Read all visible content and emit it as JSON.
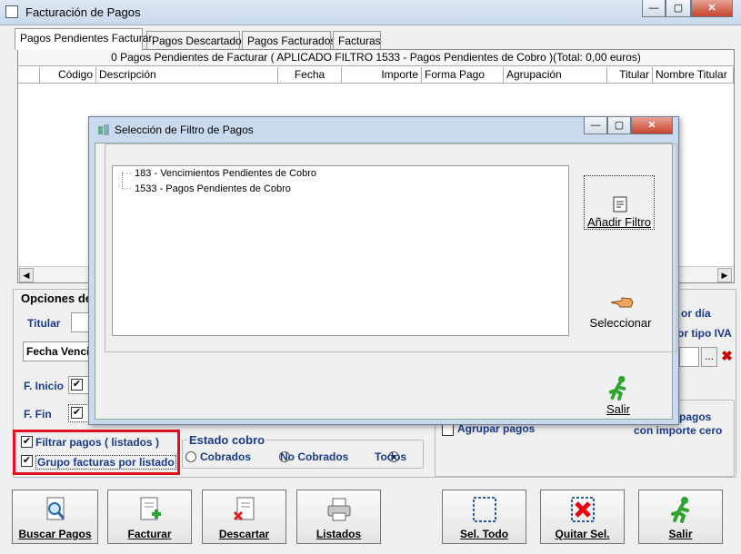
{
  "window": {
    "title": "Facturación de Pagos"
  },
  "tabs": [
    {
      "label": "Pagos Pendientes Facturar",
      "active": true
    },
    {
      "label": "Pagos Descartados"
    },
    {
      "label": "Pagos Facturados"
    },
    {
      "label": "Facturas"
    }
  ],
  "grid": {
    "info": "0 Pagos Pendientes de Facturar ( APLICADO FILTRO 1533 - Pagos Pendientes de Cobro )(Total: 0,00 euros)",
    "columns": [
      "Código",
      "Descripción",
      "Fecha",
      "Importe",
      "Forma Pago",
      "Agrupación",
      "Titular",
      "Nombre Titular"
    ]
  },
  "options": {
    "title": "Opciones de",
    "titular_label": "Titular",
    "fecha_value": "Fecha Venci",
    "finicio_label": "F. Inicio",
    "ffin_label": "F. Fin",
    "por_dia": "or día",
    "por_tipo_iva": "or tipo IVA",
    "agrupar_pagos": "Agrupar pagos",
    "pagos": "pagos",
    "importe_cero": "con importe cero"
  },
  "filters": {
    "filtrar_pagos": "Filtrar pagos ( listados )",
    "grupo_facturas": "Grupo facturas por listado",
    "estado_title": "Estado cobro",
    "cobrados": "Cobrados",
    "no_cobrados": "No Cobrados",
    "todos": "Todos"
  },
  "buttons": {
    "buscar": "Buscar Pagos",
    "facturar": "Facturar",
    "descartar": "Descartar",
    "listados": "Listados",
    "sel_todo": "Sel. Todo",
    "quitar_sel": "Quitar Sel.",
    "salir": "Salir"
  },
  "dialog": {
    "title": "Selección de Filtro de Pagos",
    "tree": [
      "183 - Vencimientos Pendientes de Cobro",
      "1533 - Pagos Pendientes de Cobro"
    ],
    "anadir": "Añadir Filtro",
    "seleccionar": "Seleccionar",
    "salir": "Salir"
  },
  "colors": {
    "highlight_border": "#e0141e",
    "label_blue": "#1a3a8c"
  }
}
